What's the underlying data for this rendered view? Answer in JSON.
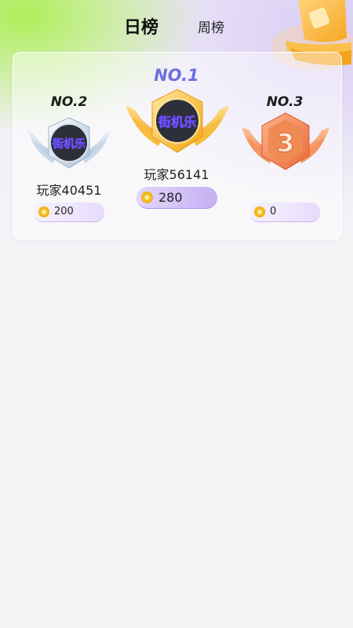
{
  "tabs": {
    "daily": "日榜",
    "weekly": "周榜"
  },
  "leaderboard": {
    "first": {
      "rank": "NO.1",
      "avatar_text": "街机乐",
      "name": "玩家56141",
      "score": "280"
    },
    "second": {
      "rank": "NO.2",
      "avatar_text": "街机乐",
      "name": "玩家40451",
      "score": "200"
    },
    "third": {
      "rank": "NO.3",
      "badge_digit": "3",
      "score": "0"
    }
  },
  "colors": {
    "green_glow": "#aaee50",
    "rank1_purple": "#6b6fe0",
    "gold": "#f5b62a",
    "orange": "#f08a55"
  },
  "icons": [
    "bell-icon",
    "coin-icon"
  ]
}
